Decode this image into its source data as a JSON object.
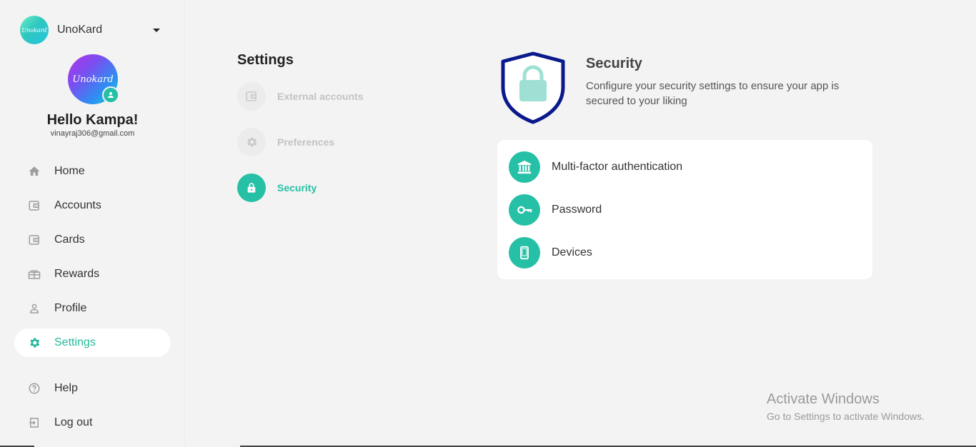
{
  "brand": {
    "name": "UnoKard",
    "logo_text": "Unokard"
  },
  "profile": {
    "avatar_text": "Unokard",
    "greeting": "Hello Kampa!",
    "email": "vinayraj306@gmail.com"
  },
  "nav": {
    "items": [
      {
        "label": "Home",
        "icon": "home-icon"
      },
      {
        "label": "Accounts",
        "icon": "wallet-icon"
      },
      {
        "label": "Cards",
        "icon": "wallet-icon"
      },
      {
        "label": "Rewards",
        "icon": "gift-icon"
      },
      {
        "label": "Profile",
        "icon": "person-icon"
      },
      {
        "label": "Settings",
        "icon": "gear-icon",
        "active": true
      }
    ],
    "footer": [
      {
        "label": "Help",
        "icon": "help-icon"
      },
      {
        "label": "Log out",
        "icon": "logout-icon"
      }
    ]
  },
  "settings": {
    "title": "Settings",
    "items": [
      {
        "label": "External accounts",
        "icon": "wallet-icon"
      },
      {
        "label": "Preferences",
        "icon": "gear-icon"
      },
      {
        "label": "Security",
        "icon": "lock-icon",
        "active": true
      }
    ]
  },
  "security": {
    "title": "Security",
    "description": "Configure your security settings to ensure your app is secured to your liking",
    "options": [
      {
        "label": "Multi-factor authentication",
        "icon": "bank-icon"
      },
      {
        "label": "Password",
        "icon": "key-icon"
      },
      {
        "label": "Devices",
        "icon": "phone-icon"
      }
    ]
  },
  "watermark": {
    "line1": "Activate Windows",
    "line2": "Go to Settings to activate Windows."
  },
  "colors": {
    "accent": "#25c0a6",
    "shield": "#0a1a8c",
    "background": "#f3f3f3"
  }
}
